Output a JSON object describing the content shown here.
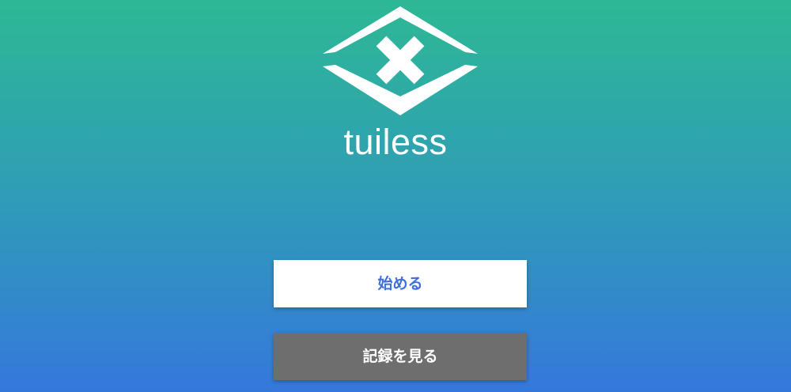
{
  "app": {
    "name": "tuiless",
    "logo_icon": "diamond-x-logo-icon"
  },
  "buttons": {
    "start_label": "始める",
    "history_label": "記録を見る"
  },
  "colors": {
    "gradient_top": "#2db894",
    "gradient_bottom": "#3578dc",
    "start_button_text": "#3f6fd8",
    "history_button_bg": "#6e6e6e"
  }
}
